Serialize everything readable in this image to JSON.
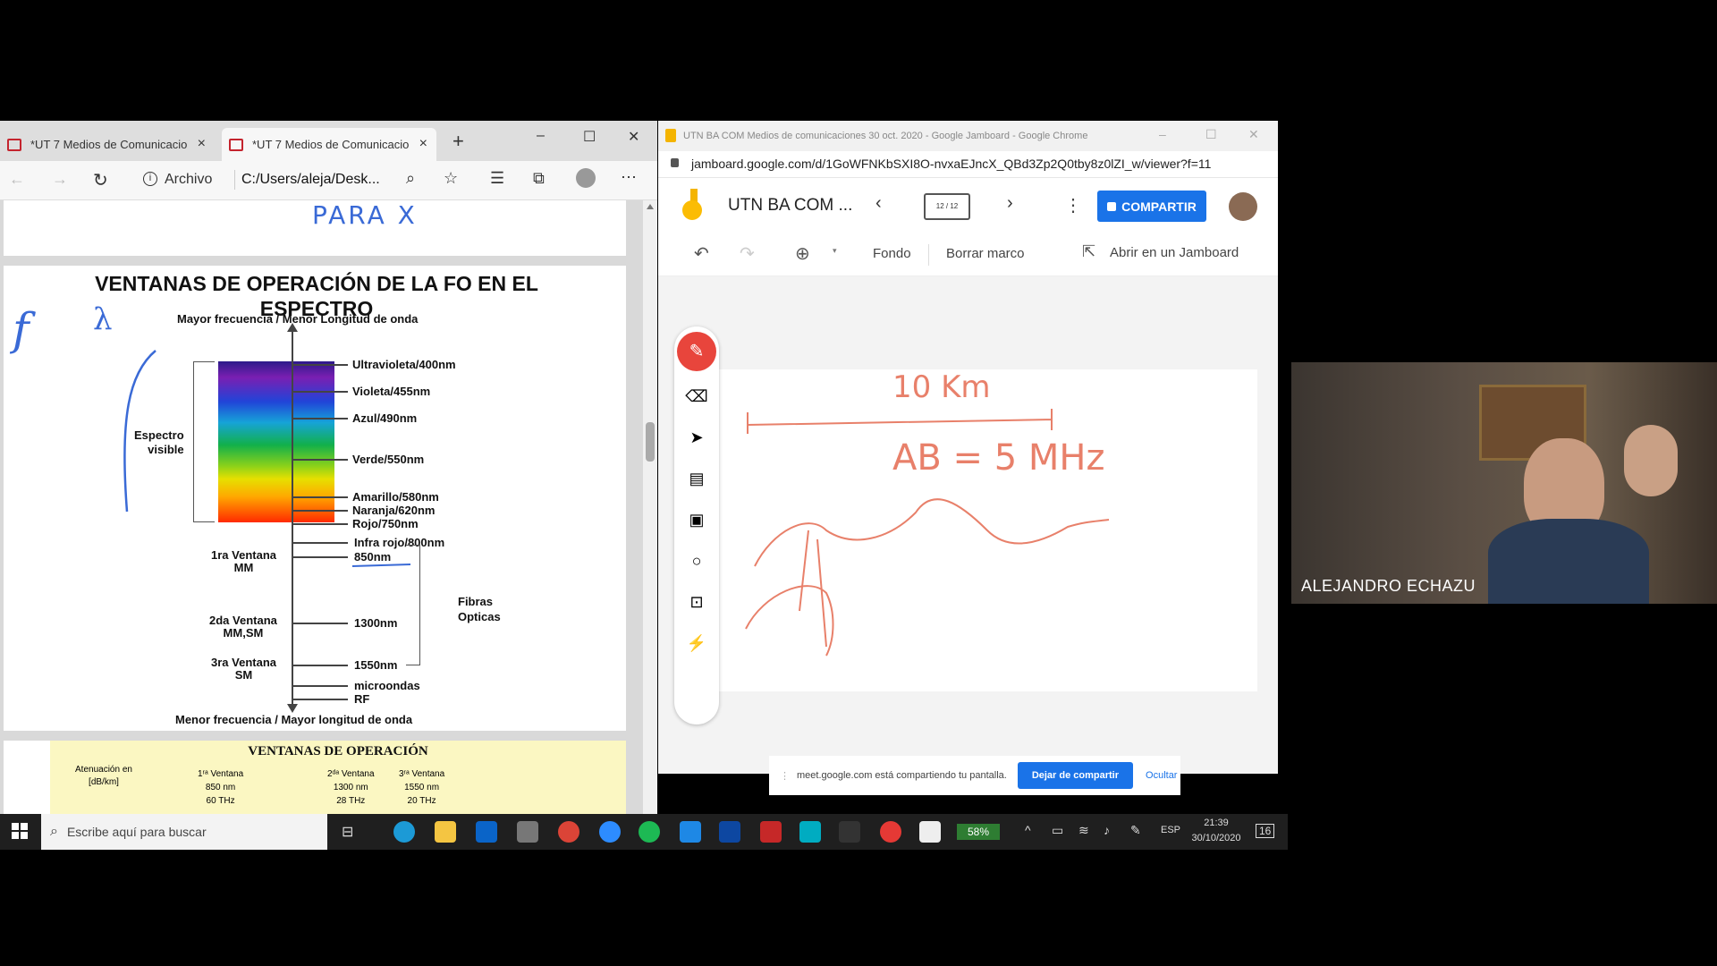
{
  "edge": {
    "tabs": [
      {
        "label": "*UT 7 Medios de Comunicacio",
        "close": "×"
      },
      {
        "label": "*UT 7 Medios de Comunicacio",
        "close": "×"
      }
    ],
    "new_tab": "+",
    "address_label": "Archivo",
    "address_value": "C:/Users/aleja/Desk...",
    "window_controls": [
      "–",
      "☐",
      "✕"
    ]
  },
  "pdf": {
    "top_handwriting": "PARA   X",
    "title_line1": "VENTANAS DE OPERACIÓN DE LA FO EN EL",
    "title_line2": "ESPECTRO",
    "top_axis": "Mayor frecuencia  /  Menor Longitud de onda",
    "bottom_axis": "Menor frecuencia  /  Mayor longitud de onda",
    "visible_label": "Espectro\nvisible",
    "spectrum_labels": [
      "Ultravioleta/400nm",
      "Violeta/455nm",
      "Azul/490nm",
      "Verde/550nm",
      "Amarillo/580nm",
      "Naranja/620nm",
      "Rojo/750nm",
      "Infra rojo/800nm",
      "850nm",
      "1300nm",
      "1550nm",
      "microondas",
      "RF"
    ],
    "windows": [
      "1ra Ventana\nMM",
      "2da Ventana\nMM,SM",
      "3ra Ventana\nSM"
    ],
    "fibras": "Fibras\nOpticas",
    "handwriting_f": "f",
    "handwriting_lambda": "λ",
    "table_title": "VENTANAS DE OPERACIÓN",
    "table_att": "Atenuación en\n[dB/km]",
    "table_cols": [
      {
        "h": "1ʳᵃ Ventana",
        "nm": "850 nm",
        "thz": "60 THz"
      },
      {
        "h": "2ᵈᵃ Ventana",
        "nm": "1300 nm",
        "thz": "28 THz"
      },
      {
        "h": "3ʳᵃ Ventana",
        "nm": "1550 nm",
        "thz": "20 THz"
      }
    ]
  },
  "chrome": {
    "title": "UTN BA COM Medios de comunicaciones 30 oct. 2020 - Google Jamboard - Google Chrome",
    "url": "jamboard.google.com/d/1GoWFNKbSXI8O-nvxaEJncX_QBd3Zp2Q0tby8z0lZI_w/viewer?f=11",
    "window_controls": [
      "–",
      "☐",
      "✕"
    ]
  },
  "jamboard": {
    "doc_title": "UTN BA COM ...",
    "frame_counter": "12 / 12",
    "share_button": "COMPARTIR",
    "tools": {
      "fondo": "Fondo",
      "borrar": "Borrar marco",
      "abrir": "Abrir en un Jamboard"
    },
    "drawing_text_1": "10 Km",
    "drawing_text_2": "AB = 5 MHz"
  },
  "share_bar": {
    "message": "meet.google.com está compartiendo tu pantalla.",
    "stop_button": "Dejar de compartir",
    "hide_link": "Ocultar"
  },
  "taskbar": {
    "search_placeholder": "Escribe aquí para buscar",
    "battery": "58%",
    "language": "ESP",
    "time": "21:39",
    "date": "30/10/2020",
    "notifications": "16"
  },
  "video": {
    "speaker_name": "ALEJANDRO ECHAZU"
  }
}
